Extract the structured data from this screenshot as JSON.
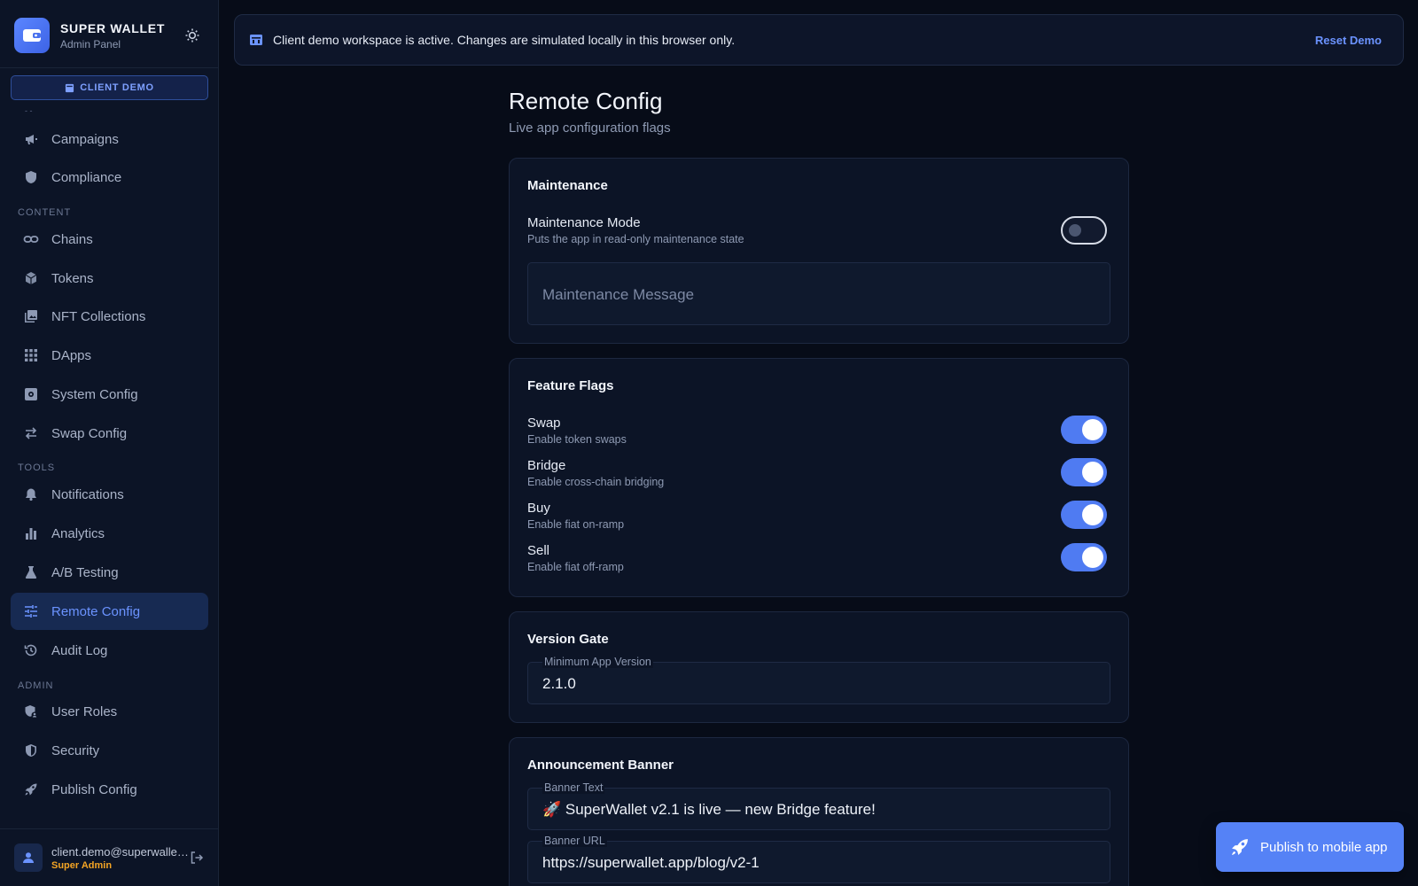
{
  "brand": {
    "title": "SUPER WALLET",
    "subtitle": "Admin Panel"
  },
  "demo_pill": "CLIENT DEMO",
  "nav_fade": "- -",
  "nav": {
    "top": [
      {
        "label": "Campaigns",
        "icon": "megaphone-icon"
      },
      {
        "label": "Compliance",
        "icon": "shield-icon"
      }
    ],
    "content_label": "CONTENT",
    "content": [
      {
        "label": "Chains",
        "icon": "link-icon"
      },
      {
        "label": "Tokens",
        "icon": "cube-icon"
      },
      {
        "label": "NFT Collections",
        "icon": "image-collection-icon"
      },
      {
        "label": "DApps",
        "icon": "grid-icon"
      },
      {
        "label": "System Config",
        "icon": "settings-box-icon"
      },
      {
        "label": "Swap Config",
        "icon": "swap-arrows-icon"
      }
    ],
    "tools_label": "TOOLS",
    "tools": [
      {
        "label": "Notifications",
        "icon": "bell-icon"
      },
      {
        "label": "Analytics",
        "icon": "bar-chart-icon"
      },
      {
        "label": "A/B Testing",
        "icon": "flask-icon"
      },
      {
        "label": "Remote Config",
        "icon": "sliders-icon",
        "active": true
      },
      {
        "label": "Audit Log",
        "icon": "history-icon"
      }
    ],
    "admin_label": "ADMIN",
    "admin": [
      {
        "label": "User Roles",
        "icon": "user-shield-icon"
      },
      {
        "label": "Security",
        "icon": "security-shield-icon"
      },
      {
        "label": "Publish Config",
        "icon": "rocket-icon"
      }
    ]
  },
  "user": {
    "email": "client.demo@superwallet.app",
    "role": "Super Admin"
  },
  "banner": {
    "text": "Client demo workspace is active. Changes are simulated locally in this browser only.",
    "reset": "Reset Demo"
  },
  "page": {
    "title": "Remote Config",
    "subtitle": "Live app configuration flags"
  },
  "maintenance": {
    "title": "Maintenance",
    "mode_label": "Maintenance Mode",
    "mode_desc": "Puts the app in read-only maintenance state",
    "mode_on": false,
    "message_placeholder": "Maintenance Message"
  },
  "feature_flags": {
    "title": "Feature Flags",
    "items": [
      {
        "label": "Swap",
        "desc": "Enable token swaps",
        "on": true
      },
      {
        "label": "Bridge",
        "desc": "Enable cross-chain bridging",
        "on": true
      },
      {
        "label": "Buy",
        "desc": "Enable fiat on-ramp",
        "on": true
      },
      {
        "label": "Sell",
        "desc": "Enable fiat off-ramp",
        "on": true
      }
    ]
  },
  "version_gate": {
    "title": "Version Gate",
    "min_version_label": "Minimum App Version",
    "min_version_value": "2.1.0"
  },
  "announcement": {
    "title": "Announcement Banner",
    "text_label": "Banner Text",
    "text_value": "🚀 SuperWallet v2.1 is live — new Bridge feature!",
    "url_label": "Banner URL",
    "url_value": "https://superwallet.app/blog/v2-1"
  },
  "fab": {
    "label": "Publish to mobile app"
  },
  "colors": {
    "accent": "#4f7bf2",
    "role": "#f5a524",
    "background": "#070c18",
    "sidebar": "#0c1426"
  }
}
